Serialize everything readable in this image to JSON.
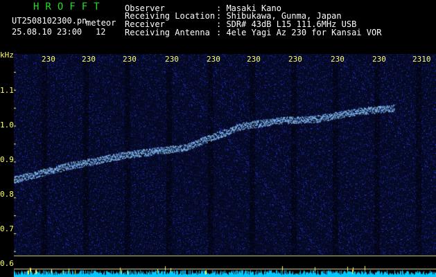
{
  "header": {
    "logo": "HROFFT",
    "filename": "UT2508102300.pn",
    "mode": "meteor",
    "datetime": "25.08.10 23:00",
    "count": "12",
    "fields": [
      {
        "label": "Observer",
        "value": ": Masaki Kano"
      },
      {
        "label": "Receiving Location",
        "value": ": Shibukawa, Gunma, Japan"
      },
      {
        "label": "Receiver",
        "value": ": SDR# 43dB L15 111.6MHz USB"
      },
      {
        "label": "Receiving Antenna",
        "value": ": 4ele Yagi Az 230 for Kansai VOR"
      }
    ]
  },
  "chart_data": {
    "type": "heatmap",
    "ylabel": "kHz",
    "y_ticks": [
      "1.1",
      "1.0",
      "0.9",
      "0.8",
      "0.7",
      "0.6"
    ],
    "ylim": [
      0.59,
      1.15
    ],
    "x_ticks": [
      "230",
      "230",
      "230",
      "230",
      "230",
      "230",
      "230",
      "230",
      "230",
      "2310"
    ],
    "trace": [
      {
        "t": 0.0,
        "f": 0.8
      },
      {
        "t": 0.15,
        "f": 0.84
      },
      {
        "t": 0.3,
        "f": 0.87
      },
      {
        "t": 0.45,
        "f": 0.89
      },
      {
        "t": 0.6,
        "f": 0.95
      },
      {
        "t": 0.7,
        "f": 0.965
      },
      {
        "t": 0.8,
        "f": 0.97
      },
      {
        "t": 0.9,
        "f": 0.99
      },
      {
        "t": 1.0,
        "f": 1.0
      }
    ],
    "colors": {
      "background": "#000000",
      "noise": "#1a2a9a",
      "signal": "#88ccff",
      "axis": "#ffff66",
      "baseline": "#00c8ff"
    }
  }
}
